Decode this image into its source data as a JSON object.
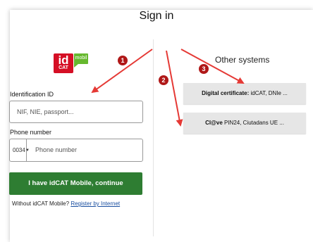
{
  "header": {
    "title": "Sign in"
  },
  "logo": {
    "id_text": "id",
    "cat_text": "CAT",
    "mobil_text": "mobil"
  },
  "form": {
    "id_label": "Identification ID",
    "id_placeholder": "NIF, NIE, passport...",
    "phone_label": "Phone number",
    "country_code": "0034",
    "phone_placeholder": "Phone number",
    "continue_label": "I have idCAT Mobile, continue",
    "footer_text": "Without idCAT Mobile?",
    "register_link": "Register by Internet"
  },
  "other": {
    "title": "Other systems",
    "cert_bold": "Digital certificate:",
    "cert_rest": " idCAT, DNIe ...",
    "clave_bold": "Cl@ve",
    "clave_rest": " PIN24, Ciutadans UE ..."
  },
  "annotations": {
    "badge1": "1",
    "badge2": "2",
    "badge3": "3",
    "color": "#e53935"
  }
}
